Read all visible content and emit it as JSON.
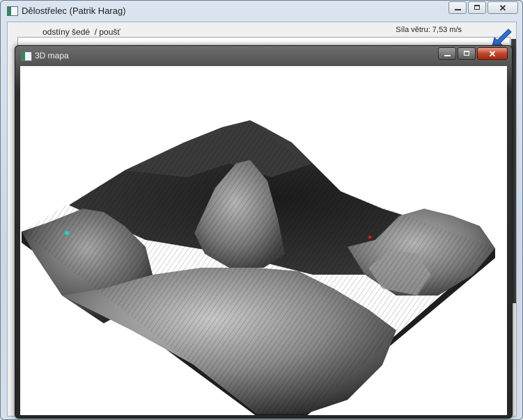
{
  "main_window": {
    "title": "Dělostřelec (Patrik Harag)",
    "menu_display": "odstíny šedé  / poušť",
    "wind_label": "Síla větru: 7,53 m/s"
  },
  "map_window": {
    "title": "3D mapa"
  },
  "markers": [
    {
      "name": "player-marker-cyan",
      "color": "#18d6e0"
    },
    {
      "name": "enemy-marker-red",
      "color": "#d11a1a"
    }
  ],
  "colors": {
    "accent_close": "#c0452b",
    "pointer_arrow": "#2f6fd1"
  }
}
